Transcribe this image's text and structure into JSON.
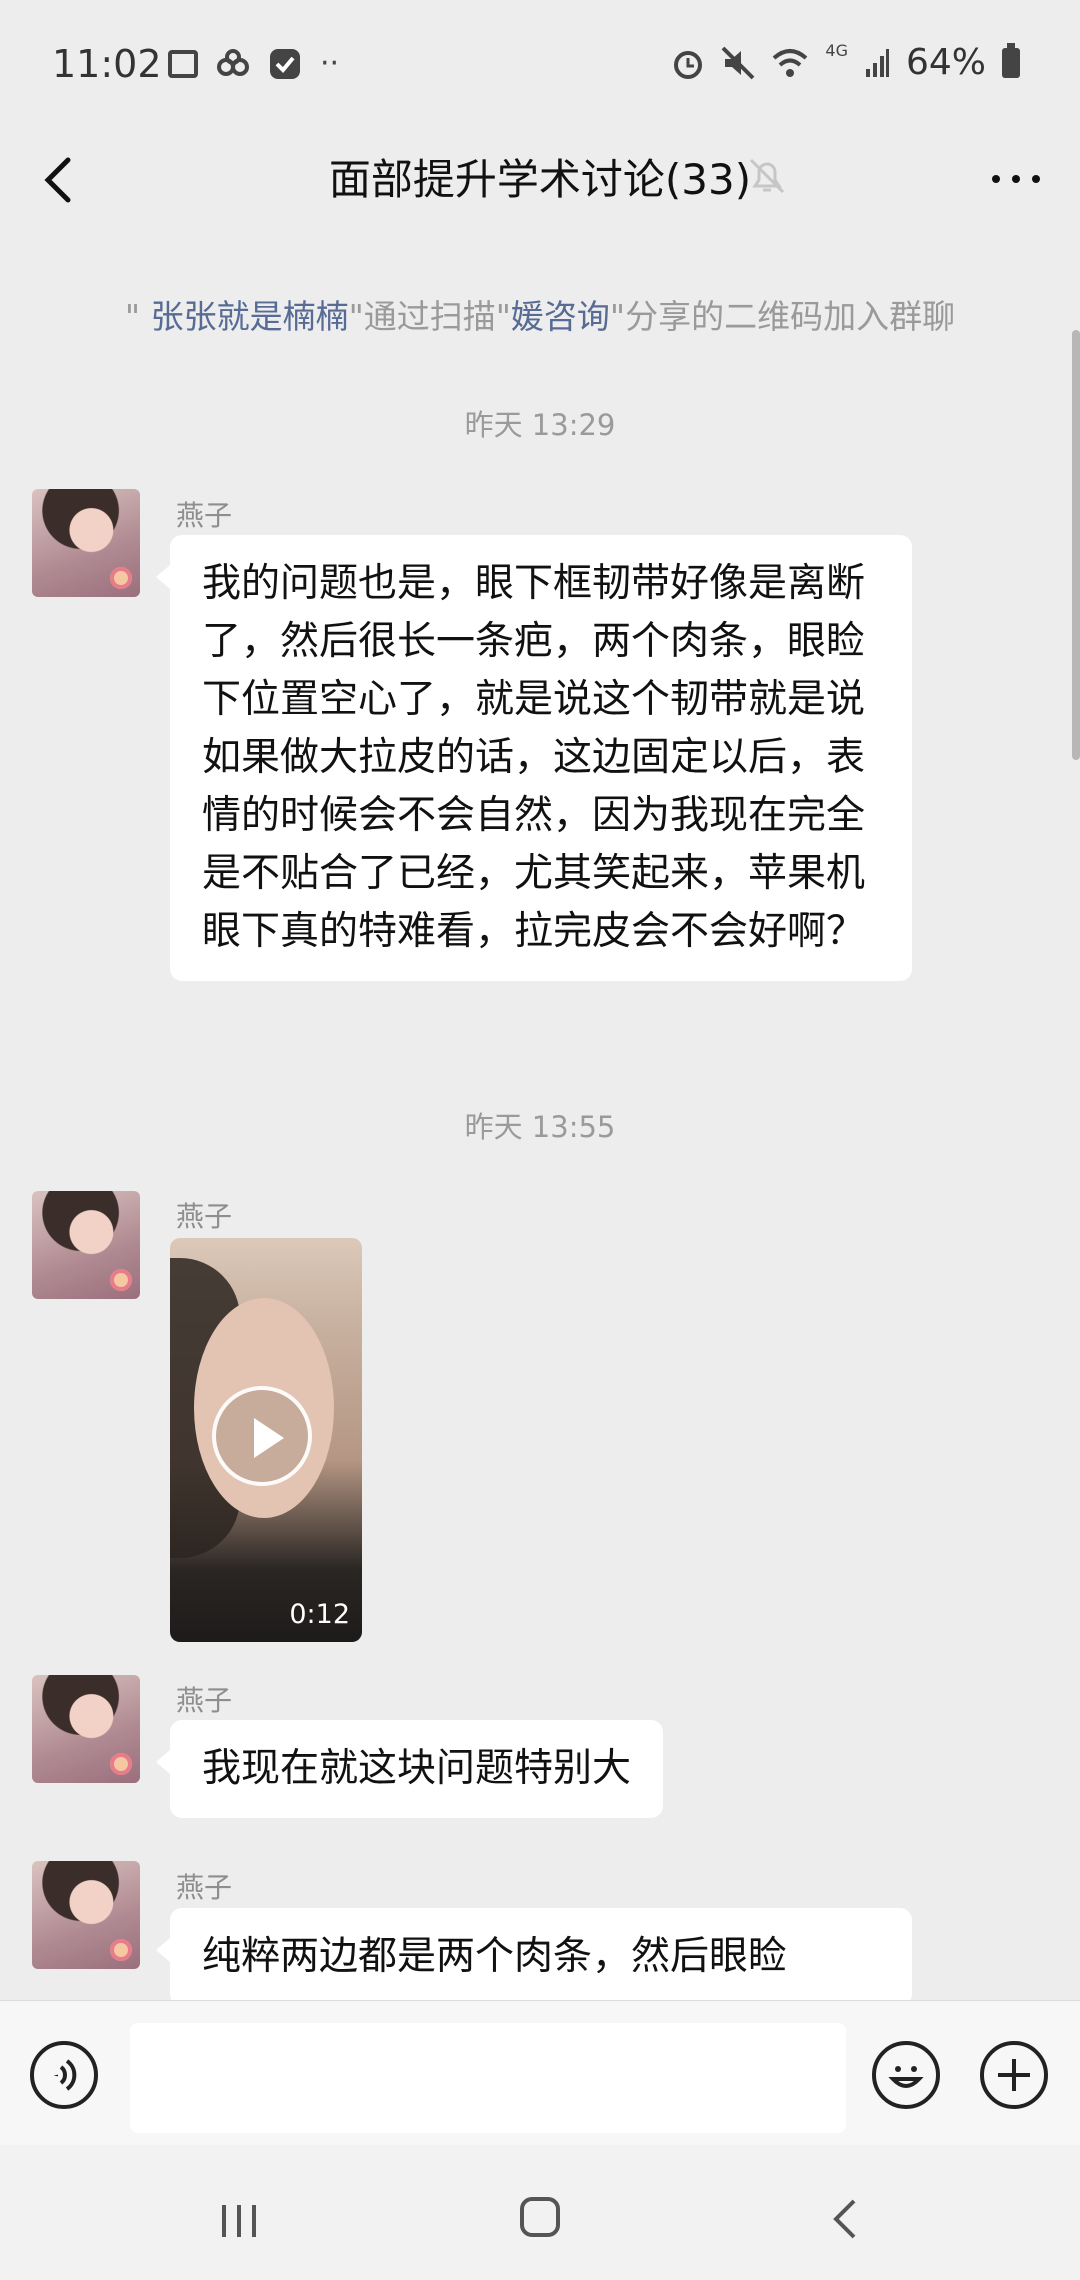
{
  "status_bar": {
    "time": "11:02",
    "network": "4G",
    "battery": "64%"
  },
  "header": {
    "title": "面部提升学术讨论(33)"
  },
  "system_note": {
    "quote_open": "\"",
    "inviter": "张张就是楠楠",
    "quote_mid": "\"通过扫描\"",
    "source": "媛咨询",
    "suffix": "\"分享的二维码加入群聊"
  },
  "timestamps": [
    "昨天 13:29",
    "昨天 13:55"
  ],
  "messages": [
    {
      "sender": "燕子",
      "type": "text",
      "text": "我的问题也是，眼下框韧带好像是离断了，然后很长一条疤，两个肉条，眼睑下位置空心了，就是说这个韧带就是说如果做大拉皮的话，这边固定以后，表情的时候会不会自然，因为我现在完全是不贴合了已经，尤其笑起来，苹果机眼下真的特难看，拉完皮会不会好啊？"
    },
    {
      "sender": "燕子",
      "type": "video",
      "duration": "0:12"
    },
    {
      "sender": "燕子",
      "type": "text",
      "text": "我现在就这块问题特别大"
    },
    {
      "sender": "燕子",
      "type": "text",
      "text": "纯粹两边都是两个肉条，然后眼睑"
    }
  ],
  "input": {
    "placeholder": ""
  }
}
